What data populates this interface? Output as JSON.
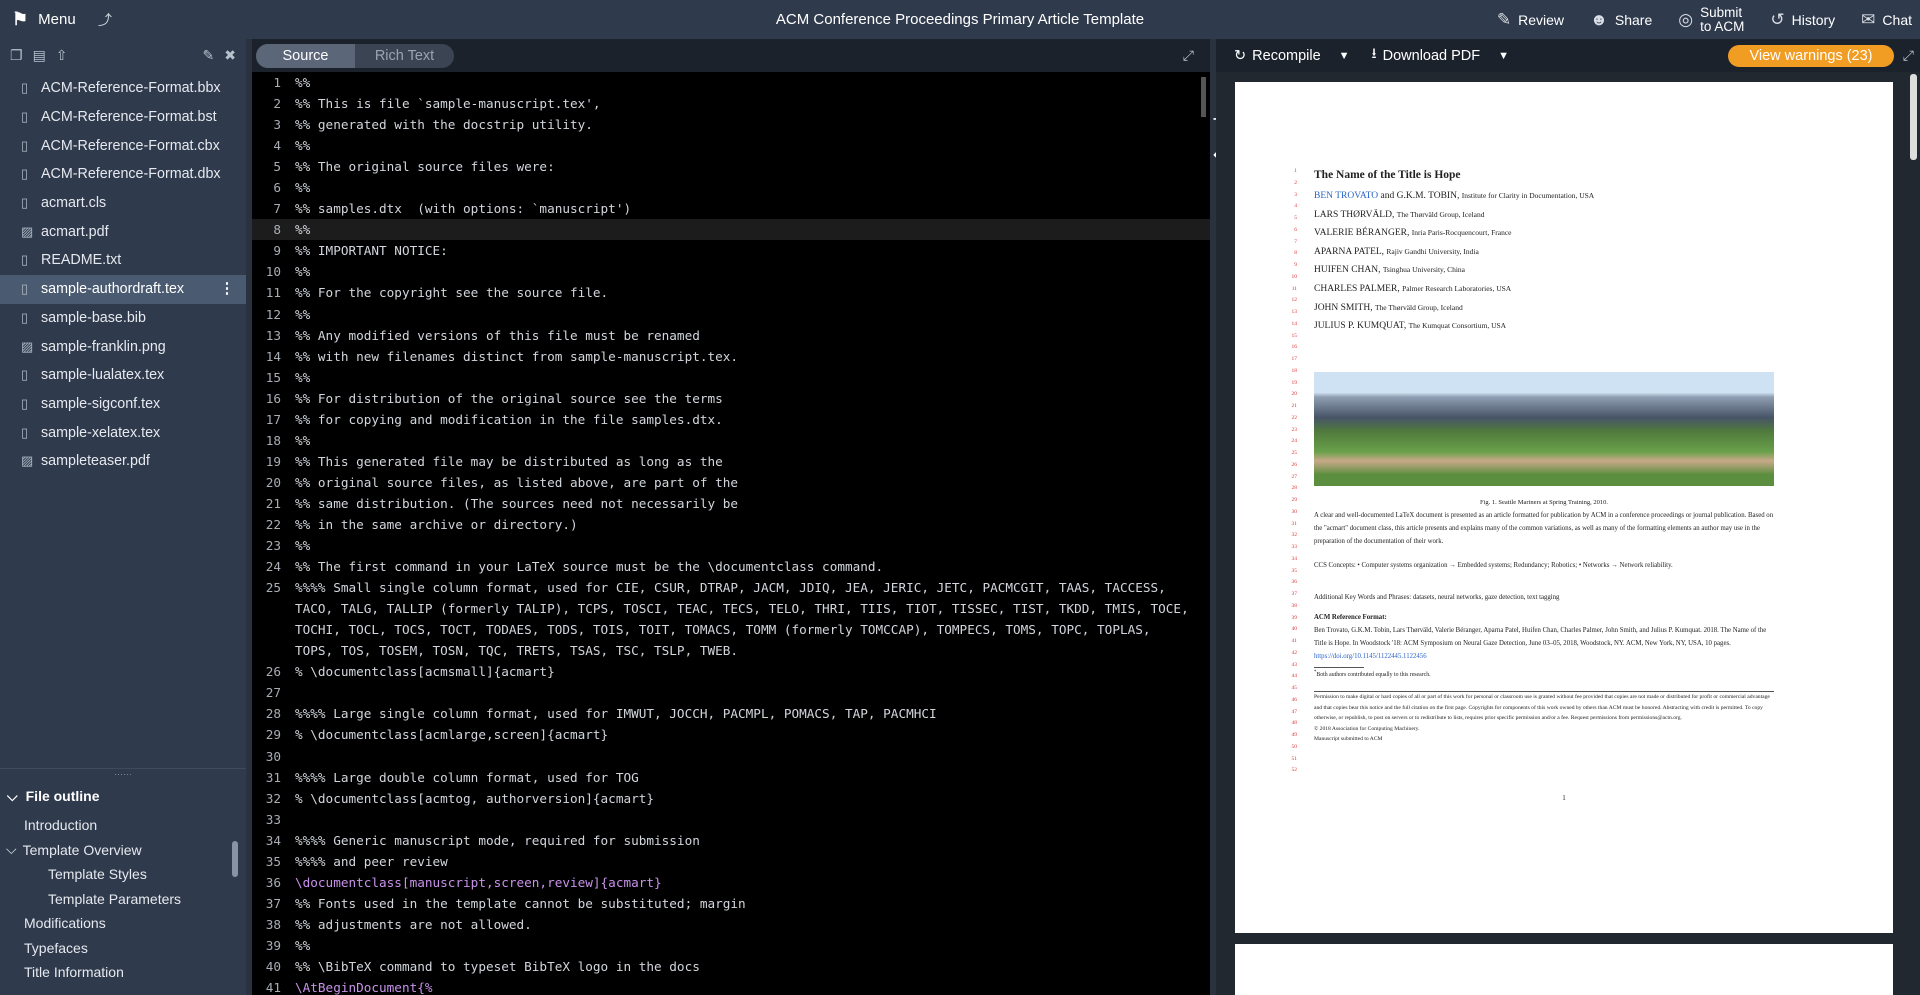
{
  "topbar": {
    "menu_label": "Menu",
    "title": "ACM Conference Proceedings Primary Article Template",
    "review_label": "Review",
    "share_label": "Share",
    "submit_line1": "Submit",
    "submit_line2": "to ACM",
    "history_label": "History",
    "chat_label": "Chat"
  },
  "file_tree": [
    {
      "name": "ACM-Reference-Format.bbx",
      "type": "file"
    },
    {
      "name": "ACM-Reference-Format.bst",
      "type": "file"
    },
    {
      "name": "ACM-Reference-Format.cbx",
      "type": "file"
    },
    {
      "name": "ACM-Reference-Format.dbx",
      "type": "file"
    },
    {
      "name": "acmart.cls",
      "type": "file"
    },
    {
      "name": "acmart.pdf",
      "type": "image"
    },
    {
      "name": "README.txt",
      "type": "file"
    },
    {
      "name": "sample-authordraft.tex",
      "type": "file",
      "selected": true
    },
    {
      "name": "sample-base.bib",
      "type": "file"
    },
    {
      "name": "sample-franklin.png",
      "type": "image"
    },
    {
      "name": "sample-lualatex.tex",
      "type": "file"
    },
    {
      "name": "sample-sigconf.tex",
      "type": "file"
    },
    {
      "name": "sample-xelatex.tex",
      "type": "file"
    },
    {
      "name": "sampleteaser.pdf",
      "type": "image"
    }
  ],
  "outline": {
    "heading": "File outline",
    "items": [
      {
        "label": "Introduction",
        "level": 1
      },
      {
        "label": "Template Overview",
        "level": 1,
        "expanded": true
      },
      {
        "label": "Template Styles",
        "level": 2
      },
      {
        "label": "Template Parameters",
        "level": 2
      },
      {
        "label": "Modifications",
        "level": 1
      },
      {
        "label": "Typefaces",
        "level": 1
      },
      {
        "label": "Title Information",
        "level": 1
      }
    ]
  },
  "editor": {
    "tab_source": "Source",
    "tab_rich": "Rich Text",
    "current_line": 8,
    "lines": [
      {
        "n": 1,
        "t": "%%"
      },
      {
        "n": 2,
        "t": "%% This is file `sample-manuscript.tex',"
      },
      {
        "n": 3,
        "t": "%% generated with the docstrip utility."
      },
      {
        "n": 4,
        "t": "%%"
      },
      {
        "n": 5,
        "t": "%% The original source files were:"
      },
      {
        "n": 6,
        "t": "%%"
      },
      {
        "n": 7,
        "t": "%% samples.dtx  (with options: `manuscript')"
      },
      {
        "n": 8,
        "t": "%%"
      },
      {
        "n": 9,
        "t": "%% IMPORTANT NOTICE:"
      },
      {
        "n": 10,
        "t": "%%"
      },
      {
        "n": 11,
        "t": "%% For the copyright see the source file."
      },
      {
        "n": 12,
        "t": "%%"
      },
      {
        "n": 13,
        "t": "%% Any modified versions of this file must be renamed"
      },
      {
        "n": 14,
        "t": "%% with new filenames distinct from sample-manuscript.tex."
      },
      {
        "n": 15,
        "t": "%%"
      },
      {
        "n": 16,
        "t": "%% For distribution of the original source see the terms"
      },
      {
        "n": 17,
        "t": "%% for copying and modification in the file samples.dtx."
      },
      {
        "n": 18,
        "t": "%%"
      },
      {
        "n": 19,
        "t": "%% This generated file may be distributed as long as the"
      },
      {
        "n": 20,
        "t": "%% original source files, as listed above, are part of the"
      },
      {
        "n": 21,
        "t": "%% same distribution. (The sources need not necessarily be"
      },
      {
        "n": 22,
        "t": "%% in the same archive or directory.)"
      },
      {
        "n": 23,
        "t": "%%"
      },
      {
        "n": 24,
        "t": "%% The first command in your LaTeX source must be the \\documentclass command."
      },
      {
        "n": 25,
        "t": "%%%% Small single column format, used for CIE, CSUR, DTRAP, JACM, JDIQ, JEA, JERIC, JETC, PACMCGIT, TAAS, TACCESS, TACO, TALG, TALLIP (formerly TALIP), TCPS, TOSCI, TEAC, TECS, TELO, THRI, TIIS, TIOT, TISSEC, TIST, TKDD, TMIS, TOCE, TOCHI, TOCL, TOCS, TOCT, TODAES, TODS, TOIS, TOIT, TOMACS, TOMM (formerly TOMCCAP), TOMPECS, TOMS, TOPC, TOPLAS, TOPS, TOS, TOSEM, TOSN, TQC, TRETS, TSAS, TSC, TSLP, TWEB."
      },
      {
        "n": 26,
        "t": "% \\documentclass[acmsmall]{acmart}"
      },
      {
        "n": 27,
        "t": ""
      },
      {
        "n": 28,
        "t": "%%%% Large single column format, used for IMWUT, JOCCH, PACMPL, POMACS, TAP, PACMHCI"
      },
      {
        "n": 29,
        "t": "% \\documentclass[acmlarge,screen]{acmart}"
      },
      {
        "n": 30,
        "t": ""
      },
      {
        "n": 31,
        "t": "%%%% Large double column format, used for TOG"
      },
      {
        "n": 32,
        "t": "% \\documentclass[acmtog, authorversion]{acmart}"
      },
      {
        "n": 33,
        "t": ""
      },
      {
        "n": 34,
        "t": "%%%% Generic manuscript mode, required for submission"
      },
      {
        "n": 35,
        "t": "%%%% and peer review"
      },
      {
        "n": 36,
        "t": "\\documentclass[manuscript,screen,review]{acmart}",
        "code": true
      },
      {
        "n": 37,
        "t": "%% Fonts used in the template cannot be substituted; margin"
      },
      {
        "n": 38,
        "t": "%% adjustments are not allowed."
      },
      {
        "n": 39,
        "t": "%%"
      },
      {
        "n": 40,
        "t": "%% \\BibTeX command to typeset BibTeX logo in the docs"
      },
      {
        "n": 41,
        "t": "\\AtBeginDocument{%",
        "code": true
      }
    ]
  },
  "preview_toolbar": {
    "recompile_label": "Recompile",
    "download_label": "Download PDF",
    "warnings_label": "View warnings (23)"
  },
  "pdf": {
    "title": "The Name of the Title is Hope",
    "authors": [
      {
        "name": "BEN TROVATO",
        "aff": "Institute for Clarity in Documentation, USA",
        "first": true
      },
      {
        "name": "LARS THØRVÄLD,",
        "aff": "The Thørväld Group, Iceland"
      },
      {
        "name": "VALERIE BÉRANGER,",
        "aff": "Inria Paris-Rocquencourt, France"
      },
      {
        "name": "APARNA PATEL,",
        "aff": "Rajiv Gandhi University, India"
      },
      {
        "name": "HUIFEN CHAN,",
        "aff": "Tsinghua University, China"
      },
      {
        "name": "CHARLES PALMER,",
        "aff": "Palmer Research Laboratories, USA"
      },
      {
        "name": "JOHN SMITH,",
        "aff": "The Thørväld Group, Iceland"
      },
      {
        "name": "JULIUS P. KUMQUAT,",
        "aff": "The Kumquat Consortium, USA"
      }
    ],
    "coauthor": " and G.K.M. TOBIN",
    "caption": "Fig. 1.  Seattle Mariners at Spring Training, 2010.",
    "abstract": "A clear and well-documented LaTeX document is presented as an article formatted for publication by ACM in a conference proceedings or journal publication. Based on the \"acmart\" document class, this article presents and explains many of the common variations, as well as many of the formatting elements an author may use in the preparation of the documentation of their work.",
    "ccs": "CCS Concepts: • Computer systems organization → Embedded systems; Redundancy; Robotics; • Networks → Network reliability.",
    "keywords": "Additional Key Words and Phrases: datasets, neural networks, gaze detection, text tagging",
    "ref_heading": "ACM Reference Format:",
    "ref_text": "Ben Trovato, G.K.M. Tobin, Lars Thørväld, Valerie Béranger, Aparna Patel, Huifen Chan, Charles Palmer, John Smith, and Julius P. Kumquat. 2018. The Name of the Title is Hope. In Woodstock '18: ACM Symposium on Neural Gaze Detection, June 03–05, 2018, Woodstock, NY. ACM, New York, NY, USA, 10 pages.",
    "ref_doi": "https://doi.org/10.1145/1122445.1122456",
    "footnote": "Both authors contributed equally to this research.",
    "permission": "Permission to make digital or hard copies of all or part of this work for personal or classroom use is granted without fee provided that copies are not made or distributed for profit or commercial advantage and that copies bear this notice and the full citation on the first page. Copyrights for components of this work owned by others than ACM must be honored. Abstracting with credit is permitted. To copy otherwise, or republish, to post on servers or to redistribute to lists, requires prior specific permission and/or a fee. Request permissions from permissions@acm.org.",
    "copyright": "© 2018 Association for Computing Machinery.",
    "submitted": "Manuscript submitted to ACM",
    "page_number": "1"
  },
  "colors": {
    "accent": "#f19c23",
    "toolbar": "#2f3a4c",
    "link": "#2a64c9"
  }
}
